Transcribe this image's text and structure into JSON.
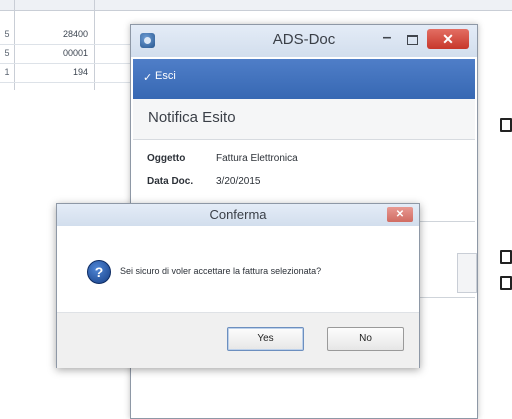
{
  "background_table": {
    "rows": [
      {
        "idx": "5",
        "value": "28400"
      },
      {
        "idx": "5",
        "value": "00001"
      },
      {
        "idx": "1",
        "value": "194"
      }
    ]
  },
  "window": {
    "title": "ADS-Doc",
    "minimize": "–",
    "close": "✕",
    "toolbar": {
      "esci_label": "Esci",
      "esci_icon": "check-arrow-icon"
    },
    "panel_title": "Notifica Esito",
    "fields": [
      {
        "label": "Oggetto",
        "value": "Fattura Elettronica"
      },
      {
        "label": "Data Doc.",
        "value": "3/20/2015"
      }
    ]
  },
  "dialog": {
    "title": "Conferma",
    "close": "✕",
    "icon": "question-icon",
    "message": "Sei sicuro di voler accettare la fattura selezionata?",
    "buttons": {
      "yes": "Yes",
      "no": "No"
    }
  },
  "colors": {
    "accent_blue": "#3768b3",
    "close_red": "#c7372b",
    "titlebar": "#d2deed"
  }
}
